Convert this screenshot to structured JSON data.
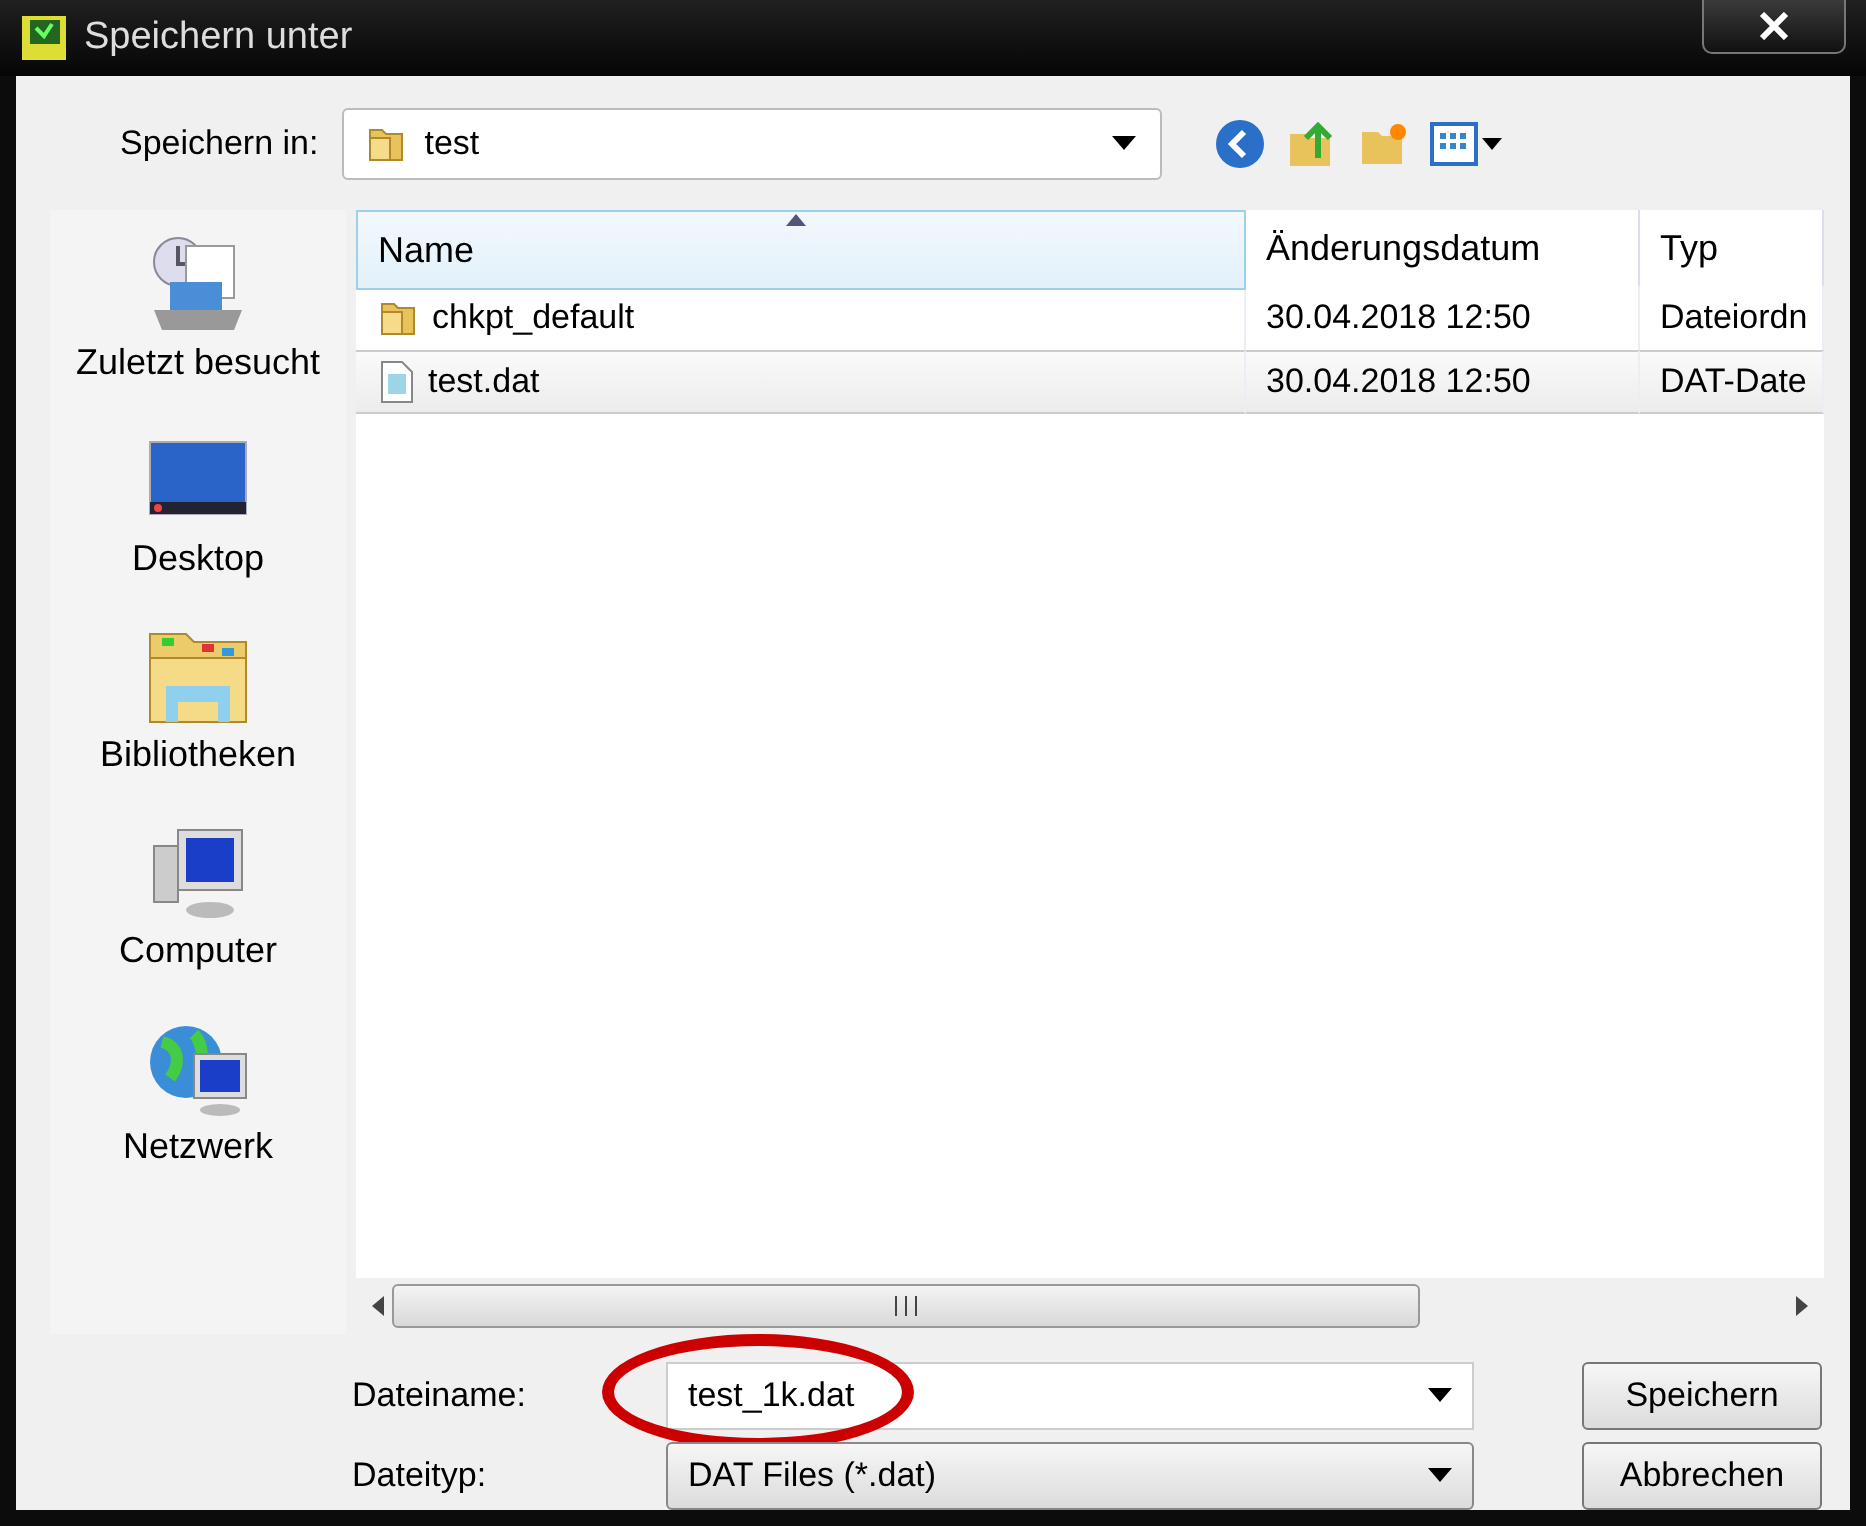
{
  "window": {
    "title": "Speichern unter"
  },
  "location": {
    "label": "Speichern in:",
    "value": "test"
  },
  "places": [
    {
      "label": "Zuletzt besucht",
      "kind": "recent"
    },
    {
      "label": "Desktop",
      "kind": "desktop"
    },
    {
      "label": "Bibliotheken",
      "kind": "libraries"
    },
    {
      "label": "Computer",
      "kind": "computer"
    },
    {
      "label": "Netzwerk",
      "kind": "network"
    }
  ],
  "table": {
    "columns": [
      {
        "label": "Name",
        "sorted": true
      },
      {
        "label": "Änderungsdatum",
        "sorted": false
      },
      {
        "label": "Typ",
        "sorted": false
      }
    ],
    "rows": [
      {
        "kind": "folder",
        "name": "chkpt_default",
        "date": "30.04.2018 12:50",
        "type": "Dateiordn",
        "selected": false
      },
      {
        "kind": "file",
        "name": "test.dat",
        "date": "30.04.2018 12:50",
        "type": "DAT-Date",
        "selected": true
      }
    ]
  },
  "filename": {
    "label": "Dateiname:",
    "value": "test_1k.dat",
    "circled": true
  },
  "filetype": {
    "label": "Dateityp:",
    "value": "DAT Files (*.dat)"
  },
  "buttons": [
    "Speichern",
    "Abbrechen"
  ]
}
